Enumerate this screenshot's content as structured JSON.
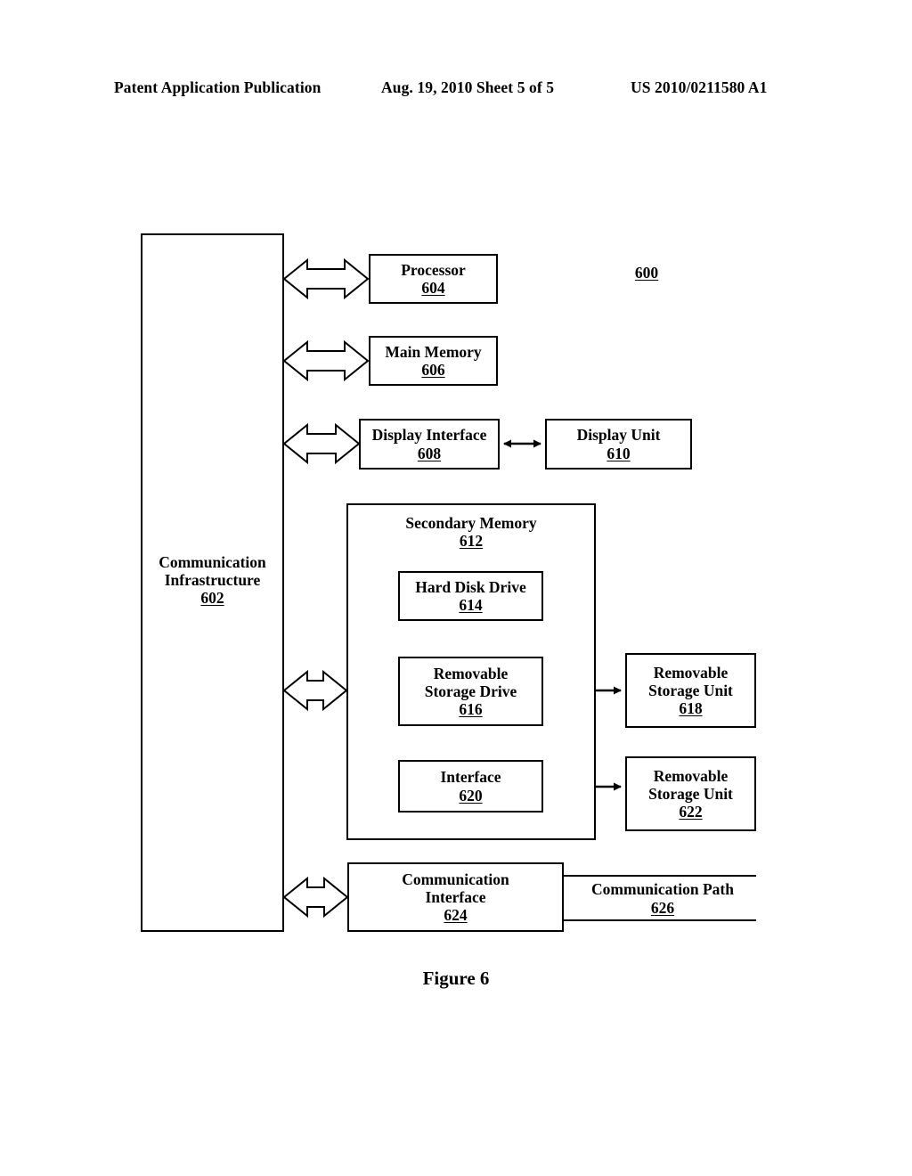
{
  "header": {
    "publication": "Patent Application Publication",
    "date_sheet": "Aug. 19, 2010  Sheet 5 of 5",
    "patent_number": "US 2010/0211580 A1"
  },
  "figure": {
    "caption": "Figure 6",
    "system_label": "600"
  },
  "blocks": {
    "infrastructure": {
      "line1": "Communication",
      "line2": "Infrastructure",
      "num": "602"
    },
    "processor": {
      "title": "Processor",
      "num": "604"
    },
    "main_memory": {
      "title": "Main Memory",
      "num": "606"
    },
    "display_interface": {
      "title": "Display Interface",
      "num": "608"
    },
    "display_unit": {
      "title": "Display Unit",
      "num": "610"
    },
    "secondary_memory": {
      "title": "Secondary Memory",
      "num": "612"
    },
    "hard_disk_drive": {
      "title": "Hard Disk Drive",
      "num": "614"
    },
    "removable_storage_drive": {
      "line1": "Removable",
      "line2": "Storage Drive",
      "num": "616"
    },
    "removable_storage_unit_618": {
      "line1": "Removable",
      "line2": "Storage Unit",
      "num": "618"
    },
    "interface_620": {
      "title": "Interface",
      "num": "620"
    },
    "removable_storage_unit_622": {
      "line1": "Removable",
      "line2": "Storage Unit",
      "num": "622"
    },
    "communication_interface": {
      "line1": "Communication",
      "line2": "Interface",
      "num": "624"
    },
    "communication_path": {
      "title": "Communication Path",
      "num": "626"
    }
  },
  "colors": {
    "ink": "#000000",
    "paper": "#ffffff"
  }
}
